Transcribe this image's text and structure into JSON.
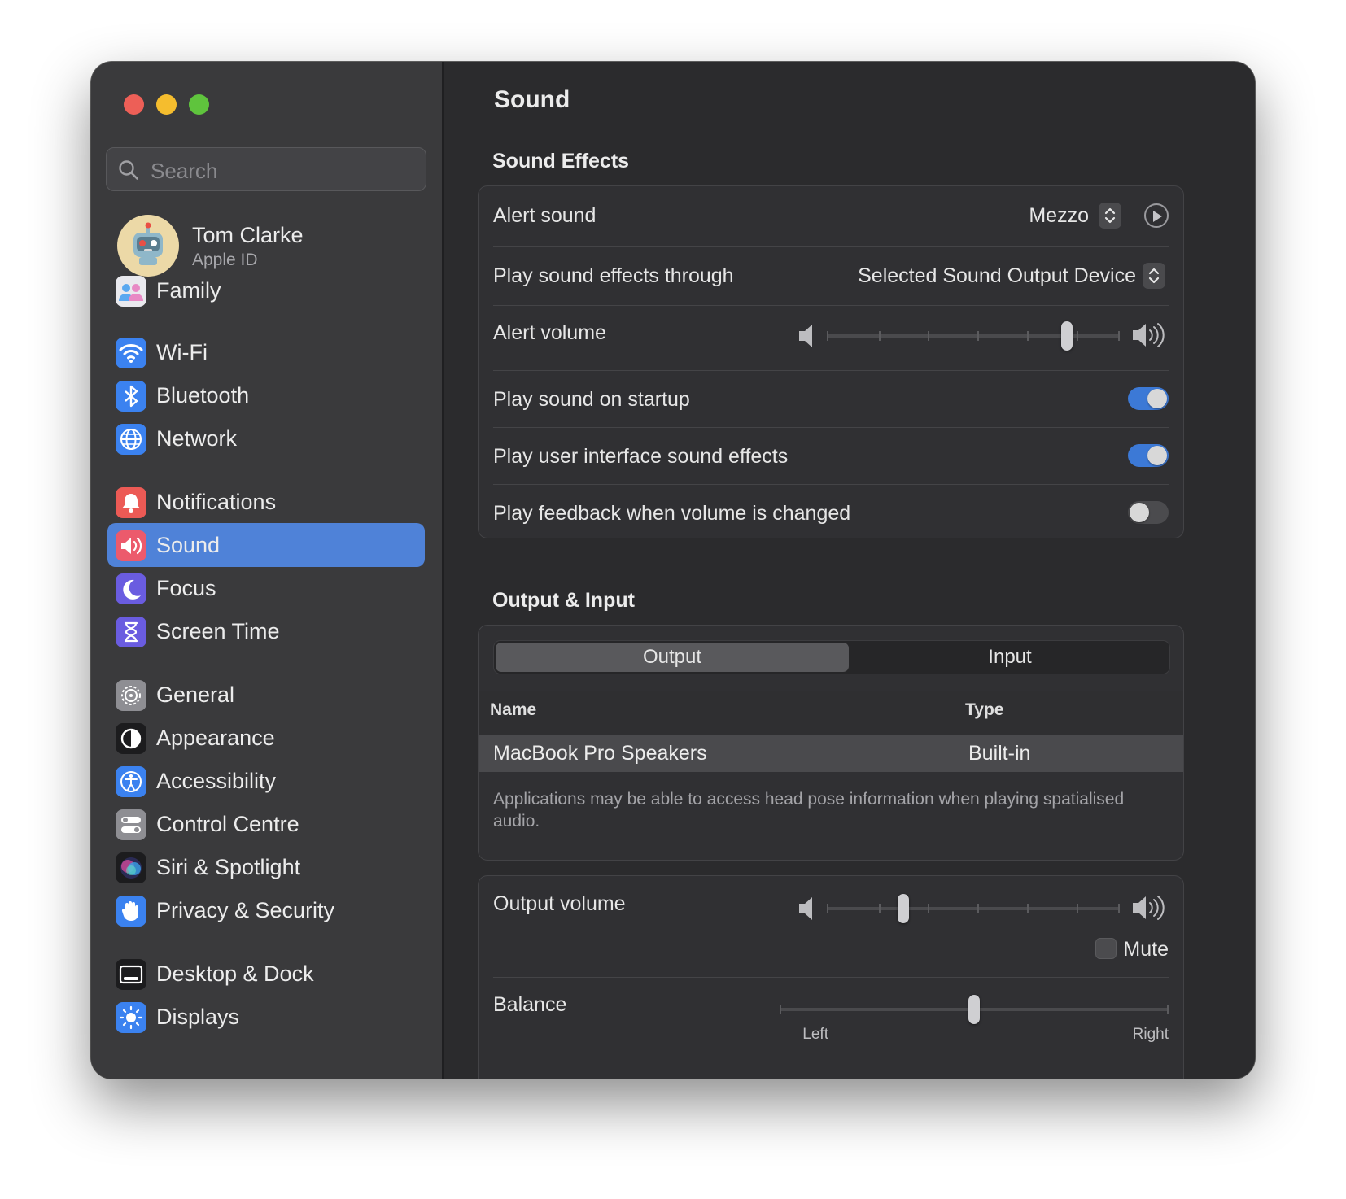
{
  "window": {
    "title": "Sound"
  },
  "sidebar": {
    "search_placeholder": "Search",
    "profile": {
      "name": "Tom Clarke",
      "subtitle": "Apple ID"
    },
    "items": [
      {
        "label": "Family",
        "icon": "family-icon"
      },
      {
        "label": "Wi-Fi",
        "icon": "wifi-icon"
      },
      {
        "label": "Bluetooth",
        "icon": "bluetooth-icon"
      },
      {
        "label": "Network",
        "icon": "globe-icon"
      },
      {
        "label": "Notifications",
        "icon": "bell-icon"
      },
      {
        "label": "Sound",
        "icon": "speaker-icon",
        "selected": true
      },
      {
        "label": "Focus",
        "icon": "moon-icon"
      },
      {
        "label": "Screen Time",
        "icon": "hourglass-icon"
      },
      {
        "label": "General",
        "icon": "gear-icon"
      },
      {
        "label": "Appearance",
        "icon": "appearance-icon"
      },
      {
        "label": "Accessibility",
        "icon": "accessibility-icon"
      },
      {
        "label": "Control Centre",
        "icon": "toggles-icon"
      },
      {
        "label": "Siri & Spotlight",
        "icon": "siri-icon"
      },
      {
        "label": "Privacy & Security",
        "icon": "hand-icon"
      },
      {
        "label": "Desktop & Dock",
        "icon": "dock-icon"
      },
      {
        "label": "Displays",
        "icon": "sun-icon"
      }
    ]
  },
  "main": {
    "title": "Sound",
    "sound_effects": {
      "heading": "Sound Effects",
      "alert_sound": {
        "label": "Alert sound",
        "value": "Mezzo"
      },
      "play_through": {
        "label": "Play sound effects through",
        "value": "Selected Sound Output Device"
      },
      "alert_volume": {
        "label": "Alert volume",
        "level": 0.82
      },
      "startup": {
        "label": "Play sound on startup",
        "on": true
      },
      "ui_sounds": {
        "label": "Play user interface sound effects",
        "on": true
      },
      "feedback": {
        "label": "Play feedback when volume is changed",
        "on": false
      }
    },
    "output_input": {
      "heading": "Output & Input",
      "tabs": [
        "Output",
        "Input"
      ],
      "active_tab": "Output",
      "columns": [
        "Name",
        "Type"
      ],
      "devices": [
        {
          "name": "MacBook Pro Speakers",
          "type": "Built-in"
        }
      ],
      "note": "Applications may be able to access head pose information when playing spatialised audio."
    },
    "output_volume": {
      "label": "Output volume",
      "level": 0.26,
      "mute_label": "Mute",
      "muted": false
    },
    "balance": {
      "label": "Balance",
      "level": 0.5,
      "left_label": "Left",
      "right_label": "Right"
    }
  },
  "colors": {
    "accent": "#4f82d8",
    "toggle_on": "#3c79d6",
    "close": "#ed5f57",
    "minimize": "#f5bd2e",
    "zoom": "#5fc43d"
  }
}
